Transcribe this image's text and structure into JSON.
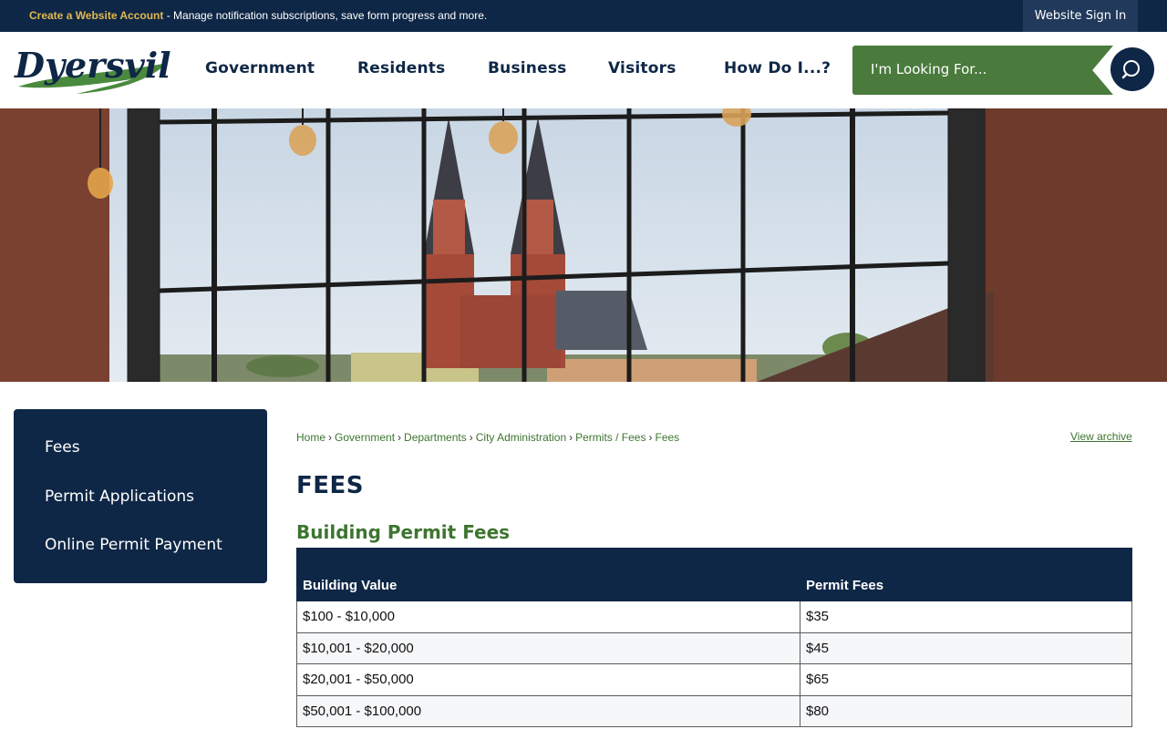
{
  "topbar": {
    "create_account_link": "Create a Website Account",
    "create_account_text": " - Manage notification subscriptions, save form progress and more.",
    "sign_in": "Website Sign In"
  },
  "header": {
    "logo_text": "Dyersville",
    "nav": [
      "Government",
      "Residents",
      "Business",
      "Visitors",
      "How Do I...?"
    ],
    "search_placeholder": "I'm Looking For..."
  },
  "sidebar": {
    "items": [
      "Fees",
      "Permit Applications",
      "Online Permit Payment"
    ]
  },
  "breadcrumb": [
    "Home",
    "Government",
    "Departments",
    "City Administration",
    "Permits / Fees",
    "Fees"
  ],
  "view_archive": "View archive",
  "page_title": "FEES",
  "section_title": "Building Permit Fees",
  "table": {
    "headers": [
      "Building Value",
      "Permit Fees"
    ],
    "rows": [
      [
        "$100 - $10,000",
        "$35"
      ],
      [
        "$10,001 - $20,000",
        "$45"
      ],
      [
        "$20,001 - $50,000",
        "$65"
      ],
      [
        "$50,001 - $100,000",
        "$80"
      ]
    ]
  },
  "colors": {
    "navy": "#0f2746",
    "green": "#4a7b3d",
    "gold": "#e0b94f"
  }
}
